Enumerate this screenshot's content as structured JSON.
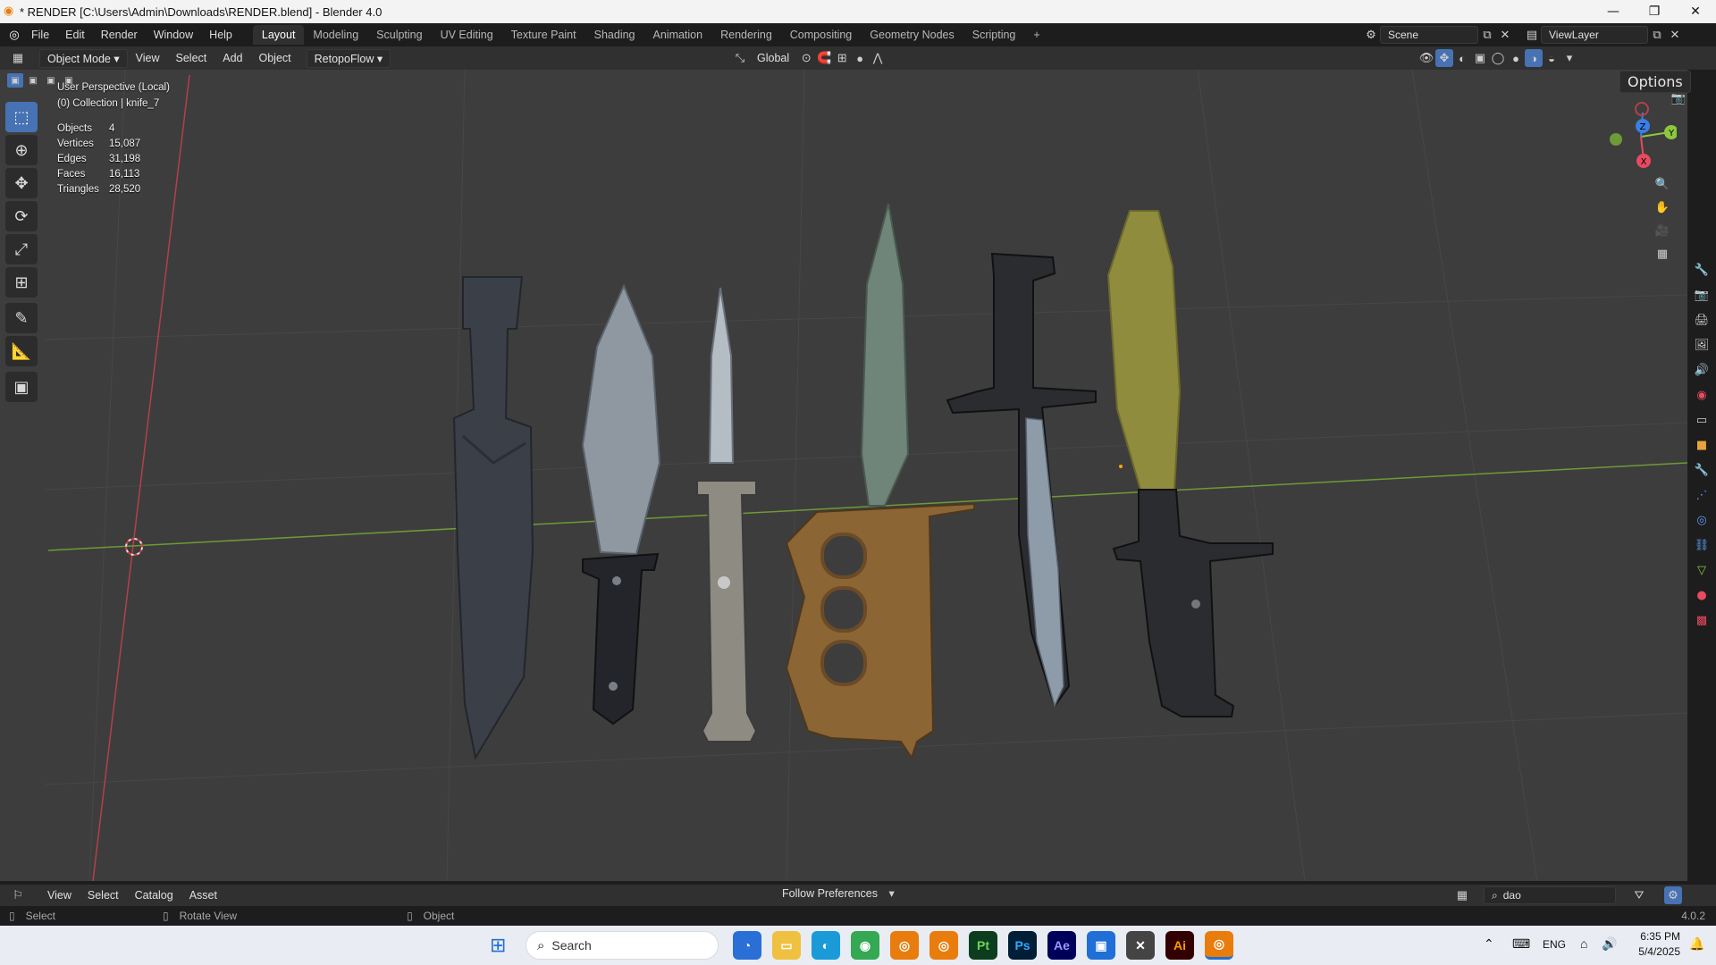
{
  "window": {
    "title": "* RENDER [C:\\Users\\Admin\\Downloads\\RENDER.blend] - Blender 4.0",
    "minimize": "—",
    "maximize": "❐",
    "close": "✕"
  },
  "menu": {
    "items": [
      "File",
      "Edit",
      "Render",
      "Window",
      "Help"
    ],
    "workspaces": [
      "Layout",
      "Modeling",
      "Sculpting",
      "UV Editing",
      "Texture Paint",
      "Shading",
      "Animation",
      "Rendering",
      "Compositing",
      "Geometry Nodes",
      "Scripting"
    ],
    "active_workspace": "Layout",
    "add_workspace": "+",
    "scene": "Scene",
    "view_layer": "ViewLayer"
  },
  "header": {
    "mode": "Object Mode",
    "view": "View",
    "select": "Select",
    "add": "Add",
    "object": "Object",
    "addon": "RetopoFlow",
    "orientation": "Global",
    "options": "Options"
  },
  "viewport": {
    "perspective": "User Perspective (Local)",
    "collection": "(0) Collection | knife_7",
    "stats": [
      {
        "label": "Objects",
        "value": "4"
      },
      {
        "label": "Vertices",
        "value": "15,087"
      },
      {
        "label": "Edges",
        "value": "31,198"
      },
      {
        "label": "Faces",
        "value": "16,113"
      },
      {
        "label": "Triangles",
        "value": "28,520"
      }
    ],
    "gizmo": {
      "x": "X",
      "y": "Y",
      "z": "Z"
    }
  },
  "bottom_bar": {
    "view": "View",
    "select": "Select",
    "catalog": "Catalog",
    "asset": "Asset",
    "import_method": "Follow Preferences",
    "search_value": "dao"
  },
  "status_bar": {
    "left_action": "Select",
    "middle_action": "Rotate View",
    "right_action": "Object",
    "version": "4.0.2"
  },
  "taskbar": {
    "search_placeholder": "Search",
    "language": "ENG",
    "time": "6:35 PM",
    "date": "5/4/2025",
    "apps": [
      "Pt",
      "Ps",
      "Ae",
      "Ai"
    ]
  },
  "colors": {
    "accent": "#4772b3",
    "x_axis": "#e84a5f",
    "y_axis": "#8cc83e",
    "z_axis": "#3b7fe6"
  }
}
